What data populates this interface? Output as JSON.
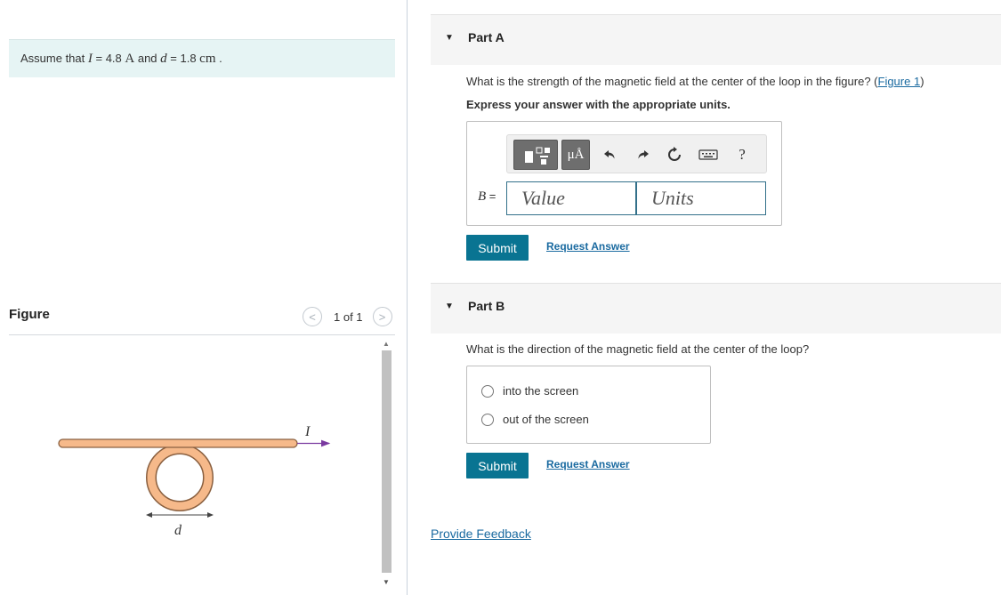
{
  "left": {
    "assume": {
      "prefix": "Assume that",
      "var_I": "I",
      "eq1": " = 4.8 ",
      "unit_A": "A",
      "mid": " and ",
      "var_d": "d",
      "eq2": " = 1.8 ",
      "unit_cm": "cm",
      "suffix": " ."
    },
    "figure": {
      "label": "Figure",
      "prev_symbol": "<",
      "next_symbol": ">",
      "count": "1 of 1",
      "current_label": "I",
      "diameter_label": "d",
      "wire_color": "#f6b98a",
      "wire_stroke": "#8a6040",
      "arrow_color": "#7a3aa0"
    }
  },
  "partA": {
    "title": "Part A",
    "question": "What is the strength of the magnetic field at the center of the loop in the figure? (",
    "figure_link": "Figure 1",
    "question_end": ")",
    "instruction": "Express your answer with the appropriate units.",
    "toolbar": {
      "mu_label": "μÅ",
      "help_label": "?"
    },
    "answer_var": "B",
    "answer_eq": " =",
    "value_placeholder": "Value",
    "units_placeholder": "Units",
    "submit": "Submit",
    "request": "Request Answer"
  },
  "partB": {
    "title": "Part B",
    "question": "What is the direction of the magnetic field at the center of the loop?",
    "choices": [
      "into the screen",
      "out of the screen"
    ],
    "submit": "Submit",
    "request": "Request Answer"
  },
  "feedback": "Provide Feedback",
  "colors": {
    "accent": "#097492",
    "link": "#1a6aa0",
    "assume_bg": "#e6f4f4"
  }
}
